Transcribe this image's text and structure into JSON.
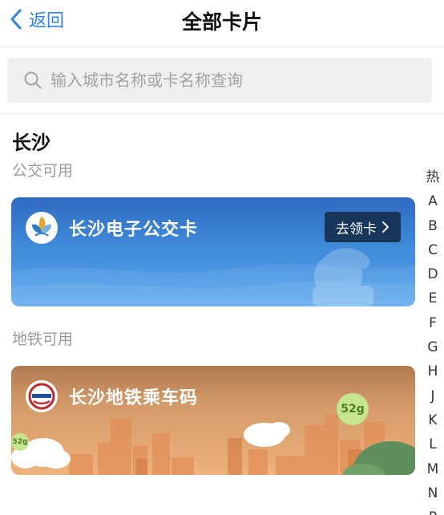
{
  "nav": {
    "back_label": "返回",
    "title": "全部卡片"
  },
  "search": {
    "placeholder": "输入城市名称或卡名称查询",
    "value": ""
  },
  "city": {
    "name": "长沙"
  },
  "sections": {
    "bus_label": "公交可用",
    "metro_label": "地铁可用"
  },
  "cards": {
    "bus": {
      "title": "长沙电子公交卡",
      "button_label": "去领卡"
    },
    "metro": {
      "title": "长沙地铁乘车码",
      "badge_large": "52g",
      "badge_small": "52g"
    }
  },
  "alpha_index": [
    "热",
    "A",
    "B",
    "C",
    "D",
    "E",
    "F",
    "G",
    "H",
    "J",
    "K",
    "L",
    "M",
    "N",
    "P"
  ],
  "colors": {
    "accent": "#2b84f0",
    "bus_card": "#3f8ad9",
    "metro_card": "#d39a68",
    "claim_button": "#17365a"
  }
}
